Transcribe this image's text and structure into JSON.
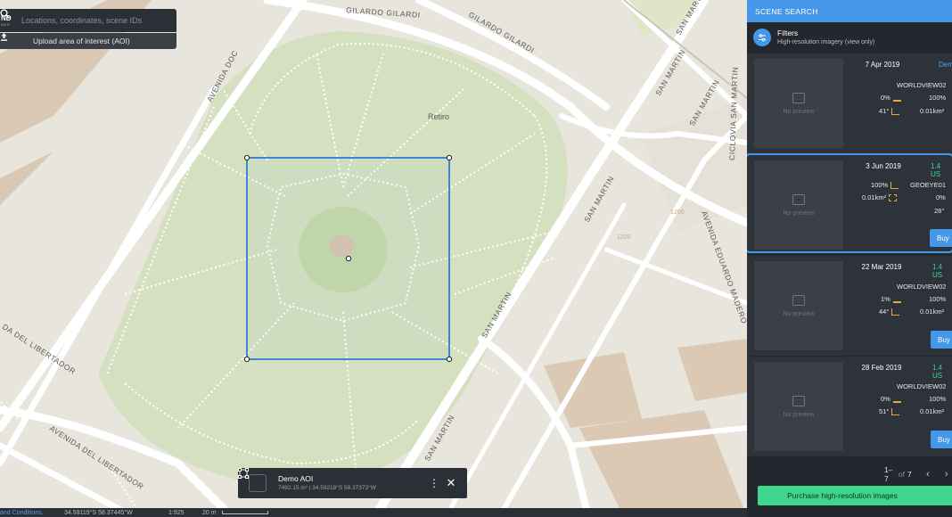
{
  "brand": {
    "main": "ND",
    "sub": "MER"
  },
  "search": {
    "placeholder": "Locations, coordinates, scene IDs"
  },
  "upload": {
    "label": "Upload area of interest (AOI)"
  },
  "map": {
    "streets": {
      "gilardo_1": "GILARDO GILARDI",
      "gilardo_2": "GILARDO GILARDI",
      "avenida_doc": "AVENIDA DOC",
      "san_martin_1": "SAN MARTIN",
      "san_martin_2": "SAN MARTIN",
      "san_martin_3": "SAN MARTIN",
      "san_martin_4": "SAN MARTIN",
      "san_martin_5": "SAN MARTIN",
      "san_martin_6": "SAN MARTIN",
      "ciclovia": "CICLOVIA SAN MARTIN",
      "eduardo_madero": "AVENIDA EDUARDO MADERO",
      "libertador_1": "DA DEL LIBERTADOR",
      "libertador_2": "AVENIDA DEL LIBERTADOR"
    },
    "place": "Retiro",
    "addr_1": "1200",
    "addr_2": "1200"
  },
  "aoi": {
    "title": "Demo AOI",
    "subtitle": "7492.15 m² | 34.59218°S 58.37373°W"
  },
  "status": {
    "terms": "and Conditions.",
    "coords": "34.59119°S 58.37445°W",
    "zoom": "1:925",
    "scale": "20 m"
  },
  "panel": {
    "header": "SCENE SEARCH",
    "filters_title": "Filters",
    "filters_subtitle": "High-resolution imagery (view only)",
    "preview_label": "No preview",
    "scenes": [
      {
        "date": "7 Apr 2019",
        "price": "Dem",
        "price_kind": "demo",
        "satellite": "WORLDVIEW02",
        "cloud": "0%",
        "coverage": "100%",
        "angle": "41°",
        "area": "0.01km²",
        "buy": ""
      },
      {
        "date": "3 Jun 2019",
        "price": "1.4 US",
        "price_kind": "usd",
        "satellite": "GEOEYE01",
        "cloud": "0%",
        "coverage": "100%",
        "angle": "28°",
        "area": "0.01km²",
        "buy": "Buy"
      },
      {
        "date": "22 Mar 2019",
        "price": "1.4 US",
        "price_kind": "usd",
        "satellite": "WORLDVIEW02",
        "cloud": "1%",
        "coverage": "100%",
        "angle": "44°",
        "area": "0.01km²",
        "buy": "Buy"
      },
      {
        "date": "28 Feb 2019",
        "price": "1.4 US",
        "price_kind": "usd",
        "satellite": "WORLDVIEW02",
        "cloud": "0%",
        "coverage": "100%",
        "angle": "51°",
        "area": "0.01km²",
        "buy": "Buy"
      }
    ],
    "pager": {
      "range": "1–7",
      "of": "of",
      "total": "7"
    },
    "purchase": "Purchase high-resolution images"
  },
  "colors": {
    "accent": "#4597e9",
    "price_green": "#3dd68c",
    "panel_bg": "#23272e",
    "park": "#d4e0bf"
  }
}
